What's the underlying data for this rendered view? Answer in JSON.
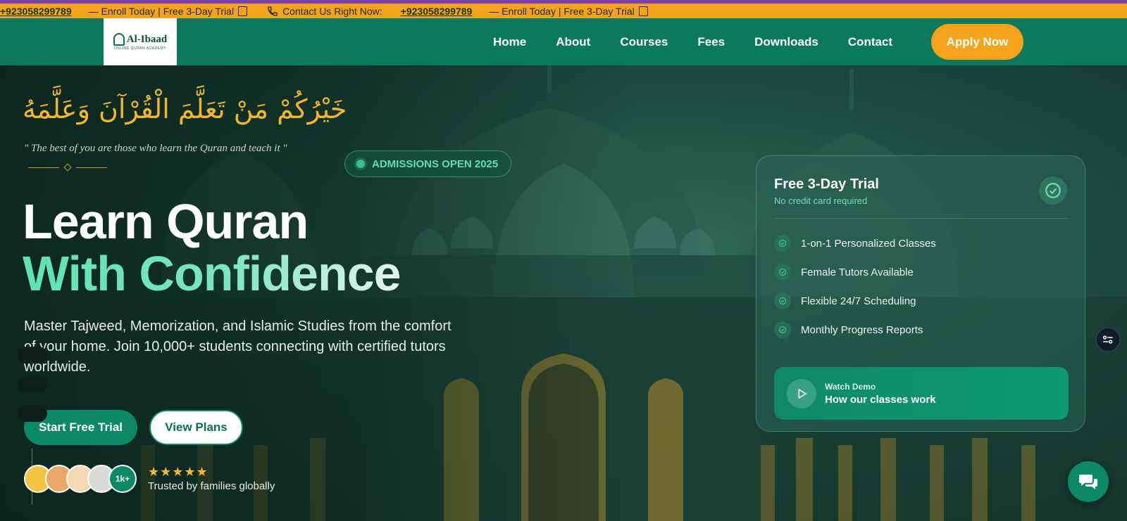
{
  "ticker": {
    "phone_1": "+923058299789",
    "message_1": "— Enroll Today | Free 3-Day Trial",
    "contact_label": "Contact Us Right Now:",
    "phone_2": "+923058299789",
    "message_2": "— Enroll Today | Free 3-Day Trial"
  },
  "nav": {
    "logo_name": "Al-Ibaad",
    "logo_tagline": "ONLINE QURAN ACADEMY",
    "links": [
      "Home",
      "About",
      "Courses",
      "Fees",
      "Downloads",
      "Contact"
    ],
    "apply_label": "Apply Now"
  },
  "hero": {
    "arabic": "خَيْرُكُمْ مَنْ تَعَلَّمَ الْقُرْآنَ وَعَلَّمَهُ",
    "quote": "\" The best of you are those who learn the Quran and teach it \"",
    "badge": "ADMISSIONS OPEN 2025",
    "heading_line1": "Learn Quran",
    "heading_line2": "With Confidence",
    "description": "Master Tajweed, Memorization, and Islamic Studies from the comfort of your home. Join 10,000+ students connecting with certified tutors worldwide.",
    "primary_cta": "Start Free Trial",
    "secondary_cta": "View Plans",
    "student_count": "1k+",
    "stars": "★★★★★",
    "rating": 5,
    "trusted_text": "Trusted by families globally"
  },
  "trial_card": {
    "title": "Free 3-Day Trial",
    "subtitle": "No credit card required",
    "features": [
      "1-on-1 Personalized Classes",
      "Female Tutors Available",
      "Flexible 24/7 Scheduling",
      "Monthly Progress Reports"
    ],
    "demo_label": "Watch Demo",
    "demo_title": "How our classes work"
  },
  "colors": {
    "ticker_bg": "#f5a31a",
    "nav_bg": "#0b7a5c",
    "accent_green": "#0b8a63",
    "accent_gold": "#f3b629",
    "mint": "#5fe3b0"
  },
  "icons": {
    "ticker_gift": "gift-icon",
    "ticker_phone": "phone-icon",
    "card_check": "check-circle-icon",
    "feature": "check-icon",
    "demo": "play-icon",
    "side_widget": "accessibility-settings-icon",
    "chat": "chat-bubbles-icon"
  }
}
